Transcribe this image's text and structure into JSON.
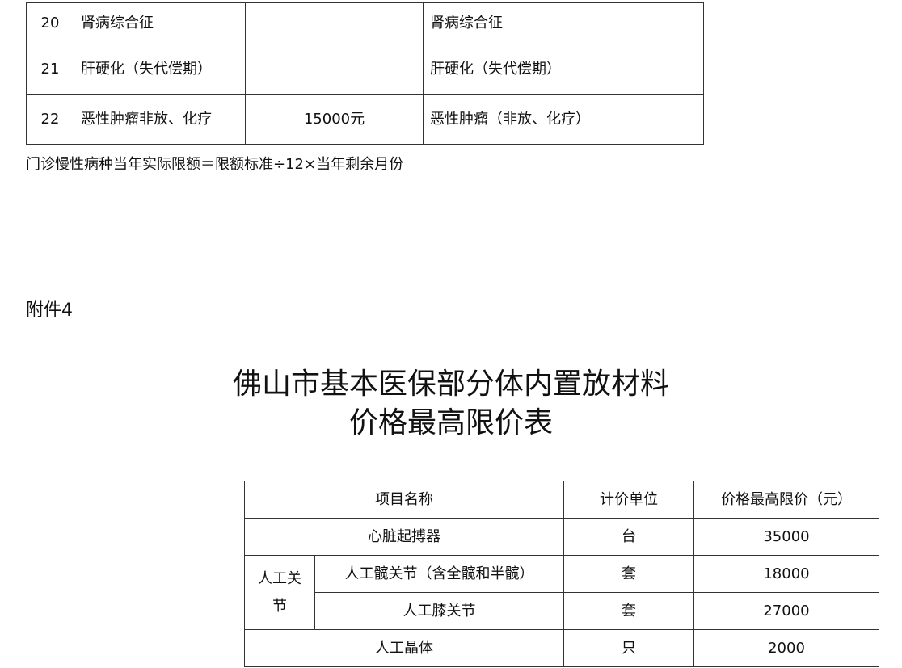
{
  "top_table": {
    "rows": [
      {
        "no": "20",
        "disease": "肾病综合征",
        "limit": "",
        "remark": "肾病综合征"
      },
      {
        "no": "21",
        "disease": "肝硬化（失代偿期）",
        "limit": "",
        "remark": "肝硬化（失代偿期）"
      },
      {
        "no": "22",
        "disease": "恶性肿瘤非放、化疗",
        "limit": "15000元",
        "remark": "恶性肿瘤（非放、化疗）"
      }
    ]
  },
  "formula_note": "门诊慢性病种当年实际限额＝限额标准÷12×当年剩余月份",
  "attachment_label": "附件4",
  "title": {
    "line1": "佛山市基本医保部分体内置放材料",
    "line2": "价格最高限价表"
  },
  "price_table": {
    "headers": {
      "item": "项目名称",
      "unit": "计价单位",
      "price": "价格最高限价（元）"
    },
    "rows": [
      {
        "item": "心脏起搏器",
        "unit": "台",
        "price": "35000"
      },
      {
        "group": "人工关节",
        "group_line1": "人工关",
        "group_line2": "节",
        "item": "人工髋关节（含全髋和半髋）",
        "unit": "套",
        "price": "18000"
      },
      {
        "item": "人工膝关节",
        "unit": "套",
        "price": "27000"
      },
      {
        "item": "人工晶体",
        "unit": "只",
        "price": "2000"
      }
    ]
  }
}
